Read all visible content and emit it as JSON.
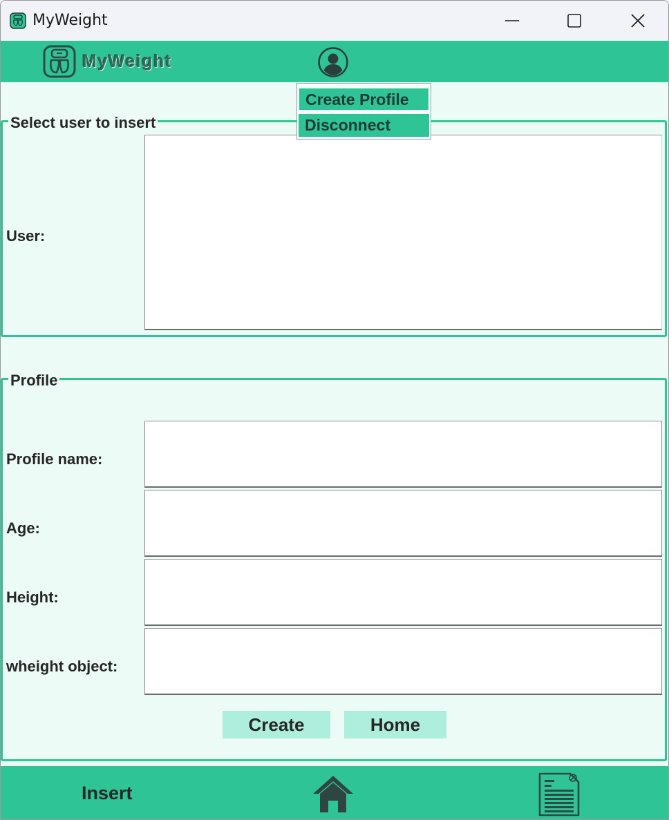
{
  "window": {
    "title": "MyWeight",
    "controls": [
      "minimize",
      "maximize",
      "close"
    ]
  },
  "header": {
    "brand": "MyWeight",
    "logo_icon": "scale-icon",
    "profile_icon": "user-circle-icon"
  },
  "dropdown": {
    "items": [
      {
        "label": "Create Profile"
      },
      {
        "label": "Disconnect"
      }
    ]
  },
  "user_group": {
    "legend": "Select user to insert",
    "user_label": "User:"
  },
  "profile_group": {
    "legend": "Profile",
    "fields": [
      {
        "label": "Profile name:",
        "value": ""
      },
      {
        "label": "Age:",
        "value": ""
      },
      {
        "label": "Height:",
        "value": ""
      },
      {
        "label": "wheight object:",
        "value": ""
      }
    ],
    "create_label": "Create",
    "home_label": "Home"
  },
  "footer": {
    "insert_label": "Insert",
    "home_icon": "home-icon",
    "doc_icon": "document-icon"
  },
  "colors": {
    "accent": "#2ec496",
    "button": "#aeeedd",
    "background": "#ecfbf5"
  }
}
